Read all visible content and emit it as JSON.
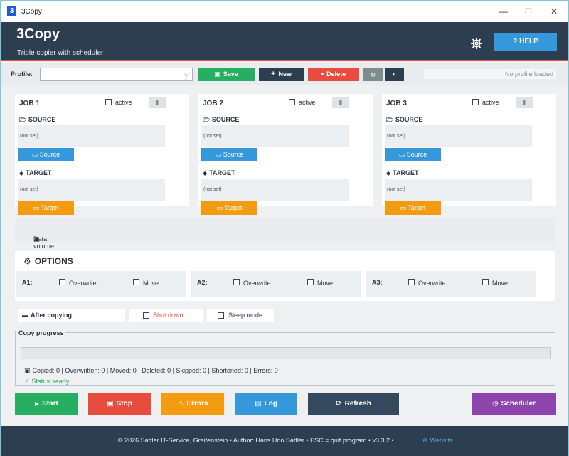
{
  "window": {
    "title": "3Copy",
    "icon_text": "3",
    "controls": {
      "minimize": "—",
      "maximize": "☐",
      "close": "✕"
    }
  },
  "header": {
    "title": "3Copy",
    "subtitle": "Triple copier with scheduler",
    "settings_icon": "gear-icon",
    "help_label": "? HELP"
  },
  "toolbar": {
    "profile_label": "Profile:",
    "profile_value": "",
    "save_label": "Save",
    "new_label": "New",
    "delete_label": "Delete",
    "status": "No profile loaded"
  },
  "jobs": [
    {
      "title": "JOB 1",
      "active_label": "active",
      "source_label": "SOURCE",
      "source_path": "(not set)",
      "source_button": "Source",
      "target_label": "TARGET",
      "target_path": "(not set)",
      "target_button": "Target"
    },
    {
      "title": "JOB 2",
      "active_label": "active",
      "source_label": "SOURCE",
      "source_path": "(not set)",
      "source_button": "Source",
      "target_label": "TARGET",
      "target_path": "(not set)",
      "target_button": "Target"
    },
    {
      "title": "JOB 3",
      "active_label": "active",
      "source_label": "SOURCE",
      "source_path": "(not set)",
      "source_button": "Source",
      "target_label": "TARGET",
      "target_path": "(not set)",
      "target_button": "Target"
    }
  ],
  "volume": {
    "text": "Data volume: no active jobs"
  },
  "options": {
    "title": "OPTIONS",
    "groups": [
      {
        "label": "A1:",
        "overwrite": "Overwrite",
        "move": "Move"
      },
      {
        "label": "A2:",
        "overwrite": "Overwrite",
        "move": "Move"
      },
      {
        "label": "A3:",
        "overwrite": "Overwrite",
        "move": "Move"
      }
    ]
  },
  "after_copying": {
    "label": "After copying:",
    "shutdown": "Shut down",
    "sleep": "Sleep mode"
  },
  "progress": {
    "legend": "Copy progress",
    "value": 0,
    "stats": "Copied: 0 | Overwritten: 0 | Moved: 0 | Deleted: 0 | Skipped: 0 | Shortened: 0 | Errors: 0",
    "status": "Status: ready"
  },
  "actions": {
    "start": "Start",
    "stop": "Stop",
    "errors": "Errors",
    "log": "Log",
    "refresh": "Refresh",
    "scheduler": "Scheduler"
  },
  "footer": {
    "text": "© 2026 Sattler IT-Service, Greifenstein  •  Author: Hans Udo Sattler  •  ESC = quit program  •  v3.3.2  •",
    "website": "Website"
  },
  "colors": {
    "header_bg": "#2c3e50",
    "accent_red": "#e74c3c",
    "blue": "#3498db",
    "green": "#27ae60",
    "orange": "#f39c12",
    "purple": "#8e44ad",
    "dark": "#34495e"
  }
}
